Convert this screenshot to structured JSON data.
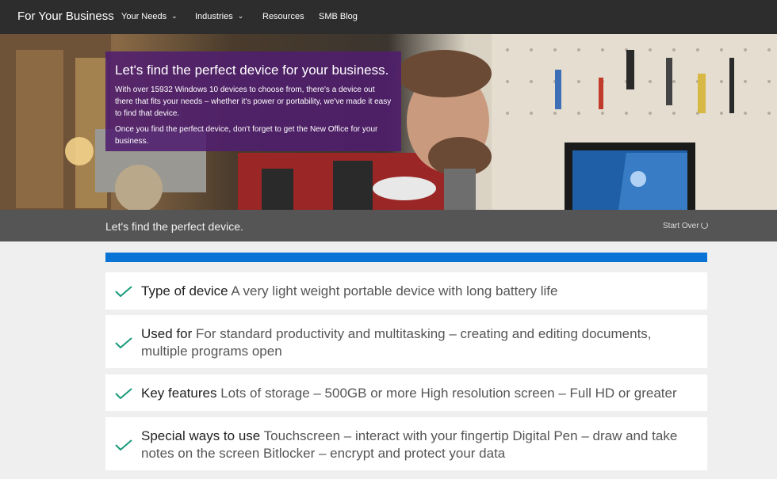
{
  "header": {
    "brand": "For Your Business",
    "nav": [
      {
        "label": "Your Needs",
        "has_dropdown": true
      },
      {
        "label": "Industries",
        "has_dropdown": true
      },
      {
        "label": "Resources",
        "has_dropdown": false
      },
      {
        "label": "SMB Blog",
        "has_dropdown": false
      }
    ],
    "chevron": "⌄"
  },
  "hero": {
    "title": "Let's find the perfect device for your business.",
    "paragraph1": "With over 15932 Windows 10 devices to choose from, there's a device out there that fits your needs – whether it's power or portability, we've made it easy to find that device.",
    "paragraph2": "Once you find the perfect device, don't forget to get the New Office for your business."
  },
  "wizard": {
    "title": "Let's find the perfect device.",
    "start_over": "Start Over",
    "progress_percent": 100,
    "progress_color": "#0a74d6"
  },
  "selections": [
    {
      "label": "Type of device",
      "value": "A very light weight portable device with long battery life"
    },
    {
      "label": "Used for",
      "value": "For standard productivity and multitasking – creating and editing documents, multiple programs open"
    },
    {
      "label": "Key features",
      "value": "Lots of storage – 500GB or more High resolution screen – Full HD or greater"
    },
    {
      "label": "Special ways to use",
      "value": "Touchscreen – interact with your fingertip Digital Pen – draw and take notes on the screen Bitlocker – encrypt and protect your data"
    }
  ],
  "colors": {
    "nav_bg": "#2d2d2d",
    "promo_bg": "#501e6e",
    "check": "#1a9a7a"
  }
}
